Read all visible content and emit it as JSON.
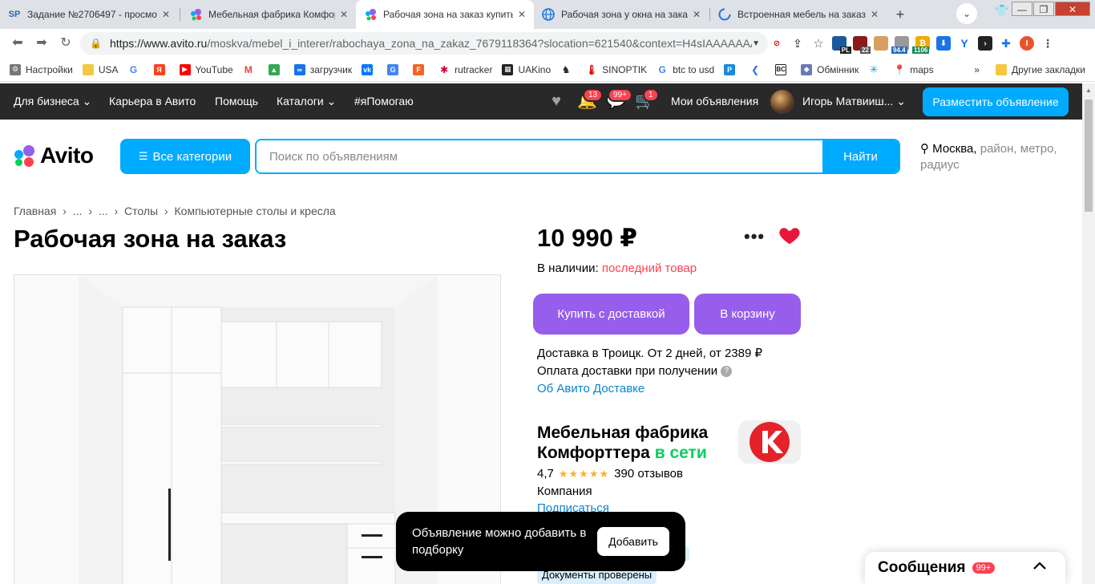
{
  "browser": {
    "tabs": [
      {
        "title": "Задание №2706497 - просмотр",
        "favicon": "SP"
      },
      {
        "title": "Мебельная фабрика Комфорттера",
        "favicon": "avito"
      },
      {
        "title": "Рабочая зона на заказ купить",
        "favicon": "avito",
        "active": true
      },
      {
        "title": "Рабочая зона у окна на заказ",
        "favicon": "globe"
      },
      {
        "title": "Встроенная мебель на заказ к",
        "favicon": "loading"
      }
    ],
    "url_host": "https://www.avito.ru",
    "url_path": "/moskva/mebel_i_interer/rabochaya_zona_na_zakaz_7679118364?slocation=621540&context=H4sIAAAAAAA...",
    "ext_badges": {
      "pl": "PL",
      "n22": "22",
      "n94": "94.4",
      "n1106": "1106"
    },
    "bookmarks": [
      "Настройки",
      "USA",
      "",
      "",
      "YouTube",
      "",
      "",
      "загрузчик",
      "",
      "",
      "",
      "rutracker",
      "UAKino",
      "",
      "SINOPTIK",
      "btc to usd",
      "",
      "",
      "",
      "Обмінник",
      "",
      "maps"
    ],
    "bookmarks_more": "»",
    "other_bookmarks": "Другие закладки"
  },
  "topbar": {
    "business": "Для бизнеса",
    "career": "Карьера в Авито",
    "help": "Помощь",
    "catalogs": "Каталоги",
    "ihelp": "#яПомогаю",
    "notif_badge": "13",
    "msg_badge": "99+",
    "cart_badge": "1",
    "my_ads": "Мои объявления",
    "user_name": "Игорь Матвииш...",
    "post_ad": "Разместить объявление"
  },
  "search": {
    "logo": "Avito",
    "categories": "Все категории",
    "placeholder": "Поиск по объявлениям",
    "button": "Найти",
    "location_city": "Москва,",
    "location_rest": "район, метро, радиус"
  },
  "breadcrumb": [
    "Главная",
    "›",
    "...",
    "›",
    "...",
    "›",
    "Столы",
    "›",
    "Компьютерные столы и кресла"
  ],
  "listing": {
    "title": "Рабочая зона на заказ",
    "price": "10 990 ₽",
    "availability_label": "В наличии:",
    "availability_value": "последний товар",
    "buy_delivery": "Купить с доставкой",
    "to_cart": "В корзину",
    "delivery_line": "Доставка в Троицк. От 2 дней, от 2389 ₽",
    "payment_line": "Оплата доставки при получении",
    "about_delivery": "Об Авито Доставке"
  },
  "seller": {
    "name": "Мебельная фабрика Комфорттера",
    "online": "в сети",
    "rating": "4,7",
    "stars": "★★★★★",
    "reviews": "390 отзывов",
    "type": "Компания",
    "subscribe": "Подписаться",
    "docs": "Документы проверены"
  },
  "toast": {
    "text": "Объявление можно добавить в подборку",
    "button": "Добавить"
  },
  "messenger": {
    "title": "Сообщения",
    "badge": "99+"
  },
  "colors": {
    "accent_blue": "#00aaff",
    "purple": "#965eeb",
    "red": "#ff4053",
    "green": "#02d15c",
    "dark": "#292929"
  }
}
